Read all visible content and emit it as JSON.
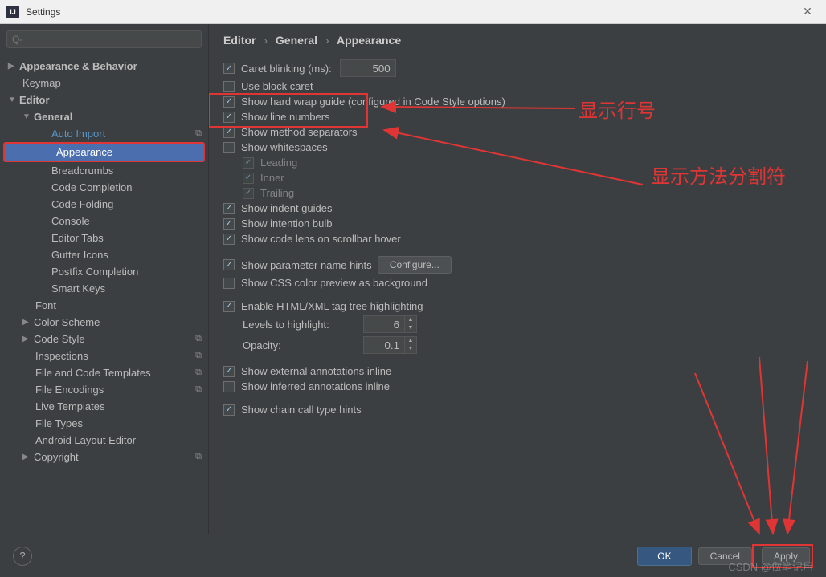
{
  "window": {
    "title": "Settings"
  },
  "search": {
    "placeholder": "Q-"
  },
  "breadcrumb": {
    "a": "Editor",
    "b": "General",
    "c": "Appearance"
  },
  "tree": {
    "appearance_behavior": "Appearance & Behavior",
    "keymap": "Keymap",
    "editor": "Editor",
    "general": "General",
    "auto_import": "Auto Import",
    "appearance": "Appearance",
    "breadcrumbs": "Breadcrumbs",
    "code_completion": "Code Completion",
    "code_folding": "Code Folding",
    "console": "Console",
    "editor_tabs": "Editor Tabs",
    "gutter_icons": "Gutter Icons",
    "postfix_completion": "Postfix Completion",
    "smart_keys": "Smart Keys",
    "font": "Font",
    "color_scheme": "Color Scheme",
    "code_style": "Code Style",
    "inspections": "Inspections",
    "file_code_templates": "File and Code Templates",
    "file_encodings": "File Encodings",
    "live_templates": "Live Templates",
    "file_types": "File Types",
    "android_layout_editor": "Android Layout Editor",
    "copyright": "Copyright"
  },
  "opts": {
    "caret_blinking": "Caret blinking (ms):",
    "caret_blinking_val": "500",
    "use_block_caret": "Use block caret",
    "show_hard_wrap": "Show hard wrap guide (configured in Code Style options)",
    "show_line_numbers": "Show line numbers",
    "show_method_separators": "Show method separators",
    "show_whitespaces": "Show whitespaces",
    "leading": "Leading",
    "inner": "Inner",
    "trailing": "Trailing",
    "show_indent_guides": "Show indent guides",
    "show_intention_bulb": "Show intention bulb",
    "show_code_lens": "Show code lens on scrollbar hover",
    "show_param_hints": "Show parameter name hints",
    "configure": "Configure...",
    "show_css_preview": "Show CSS color preview as background",
    "enable_html_tag": "Enable HTML/XML tag tree highlighting",
    "levels_label": "Levels to highlight:",
    "levels_val": "6",
    "opacity_label": "Opacity:",
    "opacity_val": "0.1",
    "show_external_annotations": "Show external annotations inline",
    "show_inferred_annotations": "Show inferred annotations inline",
    "show_chain_hints": "Show chain call type hints"
  },
  "footer": {
    "ok": "OK",
    "cancel": "Cancel",
    "apply": "Apply"
  },
  "annotations": {
    "line_numbers": "显示行号",
    "method_sep": "显示方法分割符"
  },
  "watermark": "CSDN @做笔记用"
}
